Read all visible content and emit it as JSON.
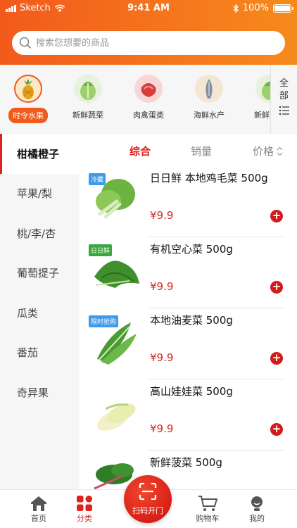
{
  "status_bar": {
    "carrier": "Sketch",
    "time": "9:41 AM",
    "battery": "100%"
  },
  "search": {
    "placeholder": "搜索您想要的商品"
  },
  "categories": [
    {
      "label": "时令水果",
      "icon": "pineapple-icon",
      "active": true
    },
    {
      "label": "新鲜蔬菜",
      "icon": "cabbage-icon"
    },
    {
      "label": "肉禽蛋类",
      "icon": "meat-icon"
    },
    {
      "label": "海鲜水产",
      "icon": "fish-icon"
    },
    {
      "label": "新鲜蔬菜",
      "icon": "cabbage-icon"
    }
  ],
  "all_button": {
    "label": "全部"
  },
  "sidebar": {
    "items": [
      {
        "label": "柑橘橙子",
        "active": true
      },
      {
        "label": "苹果/梨"
      },
      {
        "label": "桃/李/杏"
      },
      {
        "label": "葡萄提子"
      },
      {
        "label": "瓜类"
      },
      {
        "label": "番茄"
      },
      {
        "label": "奇异果"
      }
    ]
  },
  "sort": {
    "comprehensive": "综合",
    "sales": "销量",
    "price": "价格"
  },
  "products": [
    {
      "name": "日日鲜 本地鸡毛菜 500g",
      "price": "¥9.9",
      "tag": "冷藏",
      "tag_color": "#3d9be9"
    },
    {
      "name": "有机空心菜 500g",
      "price": "¥9.9",
      "tag": "日日鲜",
      "tag_color": "#3aa83a"
    },
    {
      "name": "本地油麦菜 500g",
      "price": "¥9.9",
      "tag": "限时抢购",
      "tag_color": "#3d9be9"
    },
    {
      "name": "高山娃娃菜 500g",
      "price": "¥9.9",
      "tag": "",
      "tag_color": ""
    },
    {
      "name": "新鲜菠菜 500g",
      "price": "",
      "tag": "",
      "tag_color": ""
    }
  ],
  "tabbar": {
    "home": "首页",
    "category": "分类",
    "scan": "扫码开门",
    "cart": "购物车",
    "mine": "我的"
  },
  "colors": {
    "brand_orange": "#f25a1c",
    "accent_red": "#e0221f",
    "price_red": "#d9261c"
  }
}
